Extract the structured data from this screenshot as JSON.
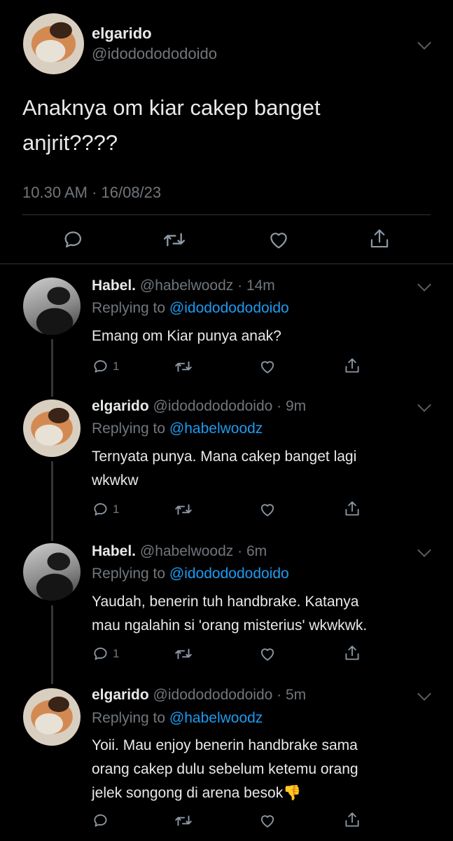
{
  "main_tweet": {
    "name": "elgarido",
    "handle": "@idododododoido",
    "text_line1": "Anaknya om kiar cakep banget",
    "text_line2": "anjrit????",
    "timestamp": "10.30 AM · 16/08/23"
  },
  "replies": [
    {
      "name": "Habel.",
      "meta": "@habelwoodz · 14m",
      "replying_label": "Replying to",
      "replying_to": "@idododododoido",
      "lines": [
        "Emang om Kiar punya anak?"
      ],
      "reply_count": "1"
    },
    {
      "name": "elgarido",
      "meta": "@idododododoido · 9m",
      "replying_label": "Replying to",
      "replying_to": "@habelwoodz",
      "lines": [
        "Ternyata punya. Mana cakep banget lagi",
        "wkwkw"
      ],
      "reply_count": "1"
    },
    {
      "name": "Habel.",
      "meta": "@habelwoodz · 6m",
      "replying_label": "Replying to",
      "replying_to": "@idododododoido",
      "lines": [
        "Yaudah, benerin tuh handbrake. Katanya",
        "mau ngalahin si 'orang misterius' wkwkwk."
      ],
      "reply_count": "1"
    },
    {
      "name": "elgarido",
      "meta": "@idododododoido · 5m",
      "replying_label": "Replying to",
      "replying_to": "@habelwoodz",
      "lines": [
        "Yoii. Mau enjoy benerin handbrake sama",
        "orang cakep dulu sebelum ketemu orang",
        "jelek songong di arena besok👎"
      ],
      "reply_count": ""
    }
  ],
  "icons": {
    "reply": "speech-bubble",
    "retweet": "retweet-arrows",
    "like": "heart",
    "share": "share-upload",
    "more": "chevron-down"
  },
  "colors": {
    "background": "#000000",
    "text": "#e7e9ea",
    "muted": "#71767b",
    "link": "#1d9bf0"
  }
}
